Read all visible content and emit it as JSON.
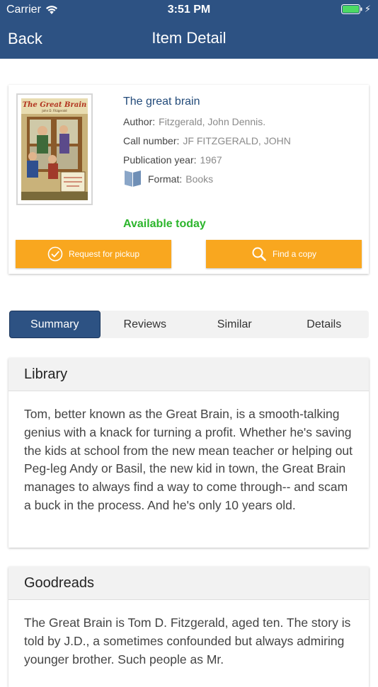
{
  "status_bar": {
    "carrier": "Carrier",
    "time": "3:51 PM",
    "battery_color": "#4cd964"
  },
  "nav": {
    "back_label": "Back",
    "title": "Item Detail"
  },
  "item": {
    "title": "The great brain",
    "cover_title": "The Great Brain",
    "cover_author": "John D. Fitzgerald",
    "author_label": "Author:",
    "author": "Fitzgerald, John Dennis.",
    "call_number_label": "Call number:",
    "call_number": "JF FITZGERALD, JOHN",
    "publication_year_label": "Publication year:",
    "publication_year": "1967",
    "format_label": "Format:",
    "format": "Books",
    "format_icon": "books-icon",
    "availability": "Available today",
    "availability_color": "#2cb52c"
  },
  "actions": {
    "request_pickup": "Request for pickup",
    "request_pickup_icon": "check-circle-icon",
    "find_copy": "Find a copy",
    "find_copy_icon": "search-icon",
    "button_color": "#f9a71f"
  },
  "tabs": [
    {
      "label": "Summary",
      "active": true
    },
    {
      "label": "Reviews",
      "active": false
    },
    {
      "label": "Similar",
      "active": false
    },
    {
      "label": "Details",
      "active": false
    }
  ],
  "sections": {
    "library": {
      "heading": "Library",
      "text": "Tom, better known as the Great Brain, is a smooth-talking genius with a knack for turning a profit. Whether he's saving the kids at school from the new mean teacher or helping out Peg-leg Andy or Basil, the new kid in town, the Great Brain manages to always find a way to come through-- and scam a buck in the process. And he's only 10 years old."
    },
    "goodreads": {
      "heading": "Goodreads",
      "text": "The Great Brain is Tom D. Fitzgerald, aged ten. The story is told by J.D., a sometimes confounded but always admiring younger brother. Such people as Mr."
    }
  },
  "theme": {
    "primary": "#2d5283",
    "accent": "#f9a71f"
  }
}
